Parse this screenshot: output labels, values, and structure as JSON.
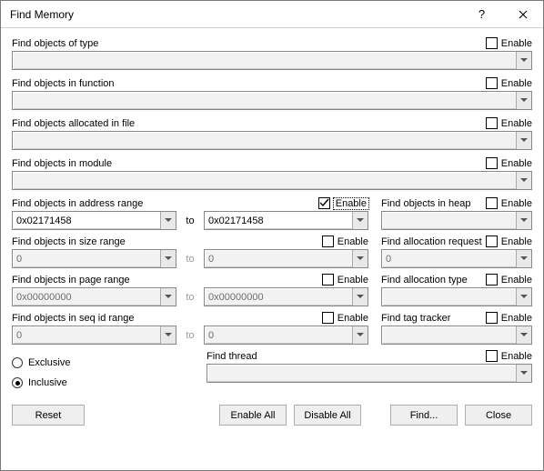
{
  "window": {
    "title": "Find Memory"
  },
  "titlebar": {
    "help_icon": "?",
    "close_icon": "✕"
  },
  "sections": {
    "type": {
      "label": "Find objects of type",
      "enable_label": "Enable",
      "checked": false,
      "value": ""
    },
    "function": {
      "label": "Find objects in function",
      "enable_label": "Enable",
      "checked": false,
      "value": ""
    },
    "file": {
      "label": "Find objects allocated in file",
      "enable_label": "Enable",
      "checked": false,
      "value": ""
    },
    "module": {
      "label": "Find objects in module",
      "enable_label": "Enable",
      "checked": false,
      "value": ""
    },
    "address": {
      "label": "Find objects in address range",
      "enable_label": "Enable",
      "checked": true,
      "from": "0x02171458",
      "to_label": "to",
      "to": "0x02171458"
    },
    "size": {
      "label": "Find objects in size range",
      "enable_label": "Enable",
      "checked": false,
      "from": "0",
      "to_label": "to",
      "to": "0"
    },
    "page": {
      "label": "Find objects in page range",
      "enable_label": "Enable",
      "checked": false,
      "from": "0x00000000",
      "to_label": "to",
      "to": "0x00000000"
    },
    "seqid": {
      "label": "Find objects in seq id range",
      "enable_label": "Enable",
      "checked": false,
      "from": "0",
      "to_label": "to",
      "to": "0"
    },
    "heap": {
      "label": "Find objects in heap",
      "enable_label": "Enable",
      "checked": false,
      "value": ""
    },
    "allocreq": {
      "label": "Find allocation request",
      "enable_label": "Enable",
      "checked": false,
      "value": "0"
    },
    "alloctype": {
      "label": "Find allocation type",
      "enable_label": "Enable",
      "checked": false,
      "value": ""
    },
    "tag": {
      "label": "Find tag tracker",
      "enable_label": "Enable",
      "checked": false,
      "value": ""
    },
    "thread": {
      "label": "Find thread",
      "enable_label": "Enable",
      "checked": false,
      "value": ""
    }
  },
  "radio": {
    "exclusive_label": "Exclusive",
    "inclusive_label": "Inclusive",
    "selected": "inclusive"
  },
  "buttons": {
    "reset": "Reset",
    "enable_all": "Enable All",
    "disable_all": "Disable All",
    "find": "Find...",
    "close": "Close"
  }
}
